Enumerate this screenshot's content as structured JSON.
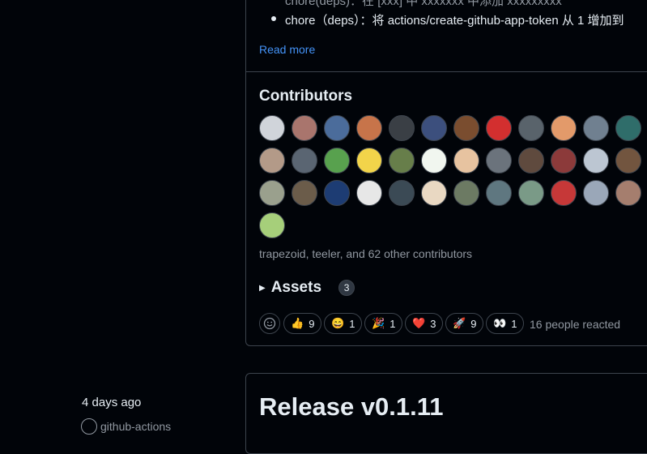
{
  "release_notes": {
    "partial_line": "chore(deps)：在 [xxx] 中 xxxxxxx 中添加 xxxxxxxxx",
    "bullet_text": "chore（deps）：将 actions/create-github-app-token 从 1 增加到",
    "read_more_label": "Read more"
  },
  "contributors": {
    "heading": "Contributors",
    "avatars": [
      {
        "name": "avatar-1",
        "color": "#d0d4da"
      },
      {
        "name": "avatar-2",
        "color": "#a9756d"
      },
      {
        "name": "avatar-3",
        "color": "#4b6c9b"
      },
      {
        "name": "avatar-4",
        "color": "#c7744a"
      },
      {
        "name": "avatar-5",
        "color": "#3a3f45"
      },
      {
        "name": "avatar-6",
        "color": "#3c4f7d"
      },
      {
        "name": "avatar-7",
        "color": "#7a4d2f"
      },
      {
        "name": "avatar-8",
        "color": "#d32f2f"
      },
      {
        "name": "avatar-9",
        "color": "#59636b"
      },
      {
        "name": "avatar-10",
        "color": "#e39a6a"
      },
      {
        "name": "avatar-11",
        "color": "#708090"
      },
      {
        "name": "avatar-12",
        "color": "#2f6d6a"
      },
      {
        "name": "avatar-13",
        "color": "#b39a88"
      },
      {
        "name": "avatar-14",
        "color": "#5a6572"
      },
      {
        "name": "avatar-15",
        "color": "#58a14e"
      },
      {
        "name": "avatar-16",
        "color": "#f2d44a"
      },
      {
        "name": "avatar-17",
        "color": "#677e4a"
      },
      {
        "name": "avatar-18",
        "color": "#f1f6ef"
      },
      {
        "name": "avatar-19",
        "color": "#e7c3a0"
      },
      {
        "name": "avatar-20",
        "color": "#6b737c"
      },
      {
        "name": "avatar-21",
        "color": "#5f4a3e"
      },
      {
        "name": "avatar-22",
        "color": "#8c3a3a"
      },
      {
        "name": "avatar-23",
        "color": "#bcc6d2"
      },
      {
        "name": "avatar-24",
        "color": "#72553f"
      },
      {
        "name": "avatar-25",
        "color": "#9aa08d"
      },
      {
        "name": "avatar-26",
        "color": "#6b5c4a"
      },
      {
        "name": "avatar-27",
        "color": "#1d3c73"
      },
      {
        "name": "avatar-28",
        "color": "#e7e7e7"
      },
      {
        "name": "avatar-29",
        "color": "#3b4a55"
      },
      {
        "name": "avatar-30",
        "color": "#e9d8c2"
      },
      {
        "name": "avatar-31",
        "color": "#6c7a63"
      },
      {
        "name": "avatar-32",
        "color": "#5f7780"
      },
      {
        "name": "avatar-33",
        "color": "#7a9a87"
      },
      {
        "name": "avatar-34",
        "color": "#c63838"
      },
      {
        "name": "avatar-35",
        "color": "#9aa7b8"
      },
      {
        "name": "avatar-36",
        "color": "#a57e6e"
      },
      {
        "name": "avatar-37",
        "color": "#a6cf7a"
      }
    ],
    "summary": "trapezoid, teeler, and 62 other contributors"
  },
  "assets": {
    "label": "Assets",
    "count": "3"
  },
  "reactions": {
    "items": [
      {
        "emoji": "👍",
        "count": "9"
      },
      {
        "emoji": "😄",
        "count": "1"
      },
      {
        "emoji": "🎉",
        "count": "1"
      },
      {
        "emoji": "❤️",
        "count": "3"
      },
      {
        "emoji": "🚀",
        "count": "9"
      },
      {
        "emoji": "👀",
        "count": "1"
      }
    ],
    "summary": "16 people reacted"
  },
  "next_release": {
    "date": "4 days ago",
    "author": "github-actions",
    "title": "Release v0.1.11"
  }
}
